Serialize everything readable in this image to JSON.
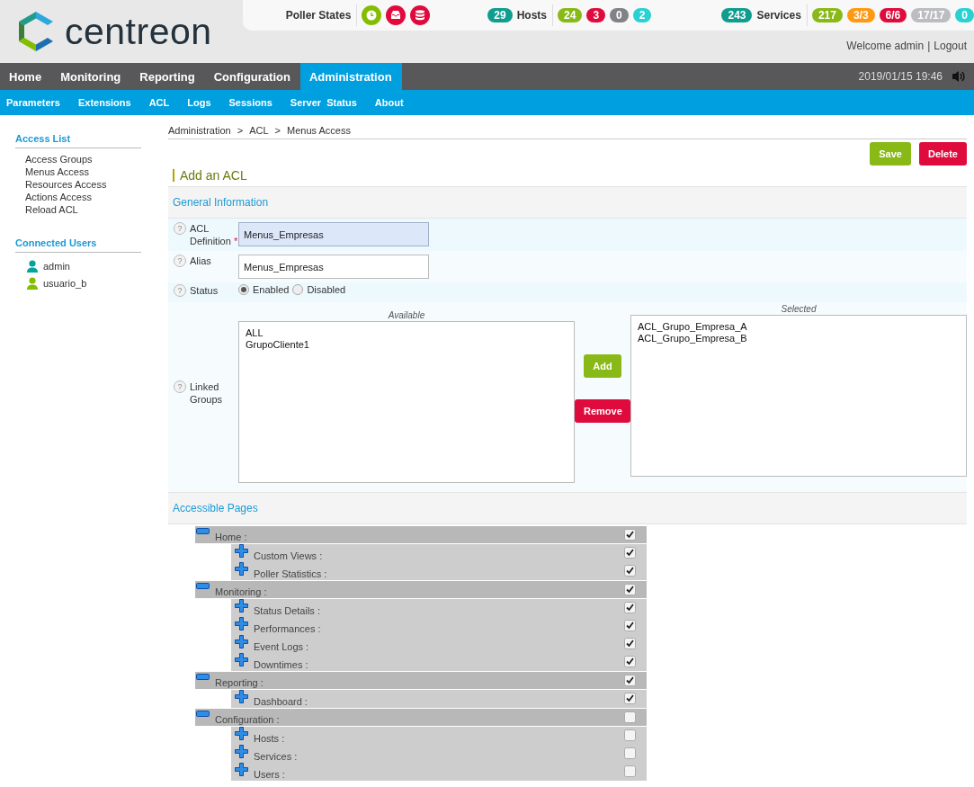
{
  "header": {
    "logo_text": "centreon",
    "poller_states": {
      "label": "Poller States",
      "icons": [
        {
          "kind": "clock",
          "color": "#84bd00"
        },
        {
          "kind": "inbox",
          "color": "#e00b3d"
        },
        {
          "kind": "database",
          "color": "#e00b3d"
        }
      ]
    },
    "hosts": {
      "total": "29",
      "label": "Hosts",
      "counts": [
        {
          "value": "24",
          "color": "#88b917"
        },
        {
          "value": "3",
          "color": "#e00b3d"
        },
        {
          "value": "0",
          "color": "#818285"
        },
        {
          "value": "2",
          "color": "#29d1d3"
        }
      ]
    },
    "services": {
      "total": "243",
      "label": "Services",
      "counts": [
        {
          "value": "217",
          "color": "#88b917"
        },
        {
          "value": "3/3",
          "color": "#ff9913"
        },
        {
          "value": "6/6",
          "color": "#e00b3d"
        },
        {
          "value": "17/17",
          "color": "#bcbdc0"
        },
        {
          "value": "0",
          "color": "#29d1d3"
        }
      ]
    },
    "welcome": "Welcome admin",
    "separator": "|",
    "logout": "Logout"
  },
  "menu": {
    "items": [
      {
        "label": "Home",
        "selected": false
      },
      {
        "label": "Monitoring",
        "selected": false
      },
      {
        "label": "Reporting",
        "selected": false
      },
      {
        "label": "Configuration",
        "selected": false
      },
      {
        "label": "Administration",
        "selected": true
      }
    ],
    "datetime": "2019/01/15 19:46"
  },
  "submenu": [
    "Parameters",
    "Extensions",
    "ACL",
    "Logs",
    "Sessions",
    "Server  Status",
    "About"
  ],
  "sidebar": {
    "access_list": {
      "title": "Access List",
      "items": [
        "Access Groups",
        "Menus Access",
        "Resources Access",
        "Actions Access",
        "Reload ACL"
      ]
    },
    "connected_users": {
      "title": "Connected Users",
      "users": [
        {
          "name": "admin",
          "color": "#00a499"
        },
        {
          "name": "usuario_b",
          "color": "#84bd00"
        }
      ]
    }
  },
  "breadcrumb": [
    "Administration",
    ">",
    "ACL",
    ">",
    "Menus Access"
  ],
  "actions": [
    {
      "label": "Save",
      "color": "#88b917"
    },
    {
      "label": "Delete",
      "color": "#e00b3d"
    }
  ],
  "form": {
    "title": "Add an ACL",
    "general": {
      "title": "General Information",
      "fields": [
        {
          "kind": "text",
          "help": "?",
          "label": "ACL Definition",
          "required_mark": "*",
          "value": "Menus_Empresas",
          "focused": true
        },
        {
          "kind": "text",
          "help": "?",
          "label": "Alias",
          "value": "Menus_Empresas",
          "focused": false
        },
        {
          "kind": "radio",
          "help": "?",
          "label": "Status",
          "options": [
            {
              "label": "Enabled",
              "selected": true
            },
            {
              "label": "Disabled",
              "selected": false
            }
          ]
        },
        {
          "kind": "transfer",
          "help": "?",
          "label": "Linked Groups",
          "available": {
            "caption": "Available",
            "items": [
              "ALL",
              "GrupoCliente1"
            ]
          },
          "chosen": {
            "caption": "Selected",
            "items": [
              "ACL_Grupo_Empresa_A",
              "ACL_Grupo_Empresa_B"
            ]
          },
          "add": "Add",
          "remove": "Remove"
        }
      ]
    }
  },
  "pages": {
    "title": "Accessible Pages",
    "tree": [
      {
        "label": "Home :",
        "expanded": true,
        "checked": true,
        "children": [
          {
            "label": "Custom Views :",
            "expanded": false,
            "checked": true
          },
          {
            "label": "Poller Statistics :",
            "expanded": false,
            "checked": true
          }
        ]
      },
      {
        "label": "Monitoring :",
        "expanded": true,
        "checked": true,
        "children": [
          {
            "label": "Status Details :",
            "expanded": false,
            "checked": true
          },
          {
            "label": "Performances :",
            "expanded": false,
            "checked": true
          },
          {
            "label": "Event Logs :",
            "expanded": false,
            "checked": true
          },
          {
            "label": "Downtimes :",
            "expanded": false,
            "checked": true
          }
        ]
      },
      {
        "label": "Reporting :",
        "expanded": true,
        "checked": true,
        "children": [
          {
            "label": "Dashboard :",
            "expanded": false,
            "checked": true
          }
        ]
      },
      {
        "label": "Configuration :",
        "expanded": true,
        "checked": false,
        "children": [
          {
            "label": "Hosts :",
            "expanded": false,
            "checked": false
          },
          {
            "label": "Services :",
            "expanded": false,
            "checked": false
          },
          {
            "label": "Users :",
            "expanded": false,
            "checked": false
          }
        ]
      }
    ]
  }
}
